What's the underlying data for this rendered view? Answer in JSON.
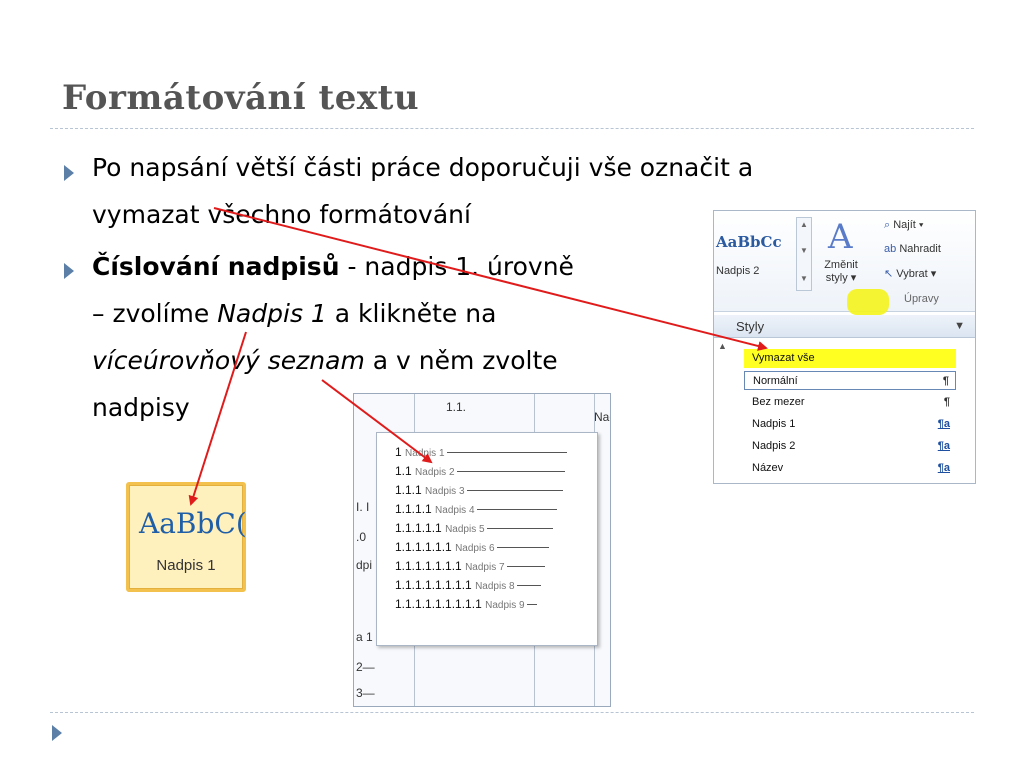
{
  "slide": {
    "title": "Formátování textu",
    "bullet1": {
      "line1": "Po napsání větší části práce doporučuji vše označit a",
      "line2": "vymazat všechno formátování"
    },
    "bullet2": {
      "bold": "Číslování nadpisů",
      "rest1": " - nadpis 1. úrovně",
      "line2a": "– zvolíme ",
      "line2b": "Nadpis 1",
      "line2c": " a klikněte na",
      "line3a": "víceúrovňový seznam",
      "line3b": " a v něm zvolte",
      "line4": "nadpisy"
    }
  },
  "style_tile": {
    "sample": "AaBbC(",
    "name": "Nadpis 1"
  },
  "ribbon": {
    "gallery_sample": "AaBbCc",
    "gallery_name": "Nadpis 2",
    "change_styles_glyph": "A",
    "change_styles_line1": "Změnit",
    "change_styles_line2": "styly ▾",
    "find": "Najít ▾",
    "replace": "Nahradit",
    "select": "Vybrat ▾",
    "group_label": "Úpravy",
    "pane_title": "Styly",
    "styles": [
      {
        "name": "Vymazat vše",
        "mark": ""
      },
      {
        "name": "Normální",
        "mark": "¶"
      },
      {
        "name": "Bez mezer",
        "mark": "¶"
      },
      {
        "name": "Nadpis 1",
        "mark": "¶a"
      },
      {
        "name": "Nadpis 2",
        "mark": "¶a"
      },
      {
        "name": "Název",
        "mark": "¶a"
      }
    ]
  },
  "multilevel": {
    "bg_top_label": "1.1.",
    "bg_right_label": "Nad",
    "bg_left": [
      "I. I",
      ".0",
      "dpi",
      "a 1",
      "2—",
      "3—"
    ],
    "levels": [
      {
        "num": "1",
        "text": "Nadpis 1"
      },
      {
        "num": "1.1",
        "text": "Nadpis 2"
      },
      {
        "num": "1.1.1",
        "text": "Nadpis 3"
      },
      {
        "num": "1.1.1.1",
        "text": "Nadpis 4"
      },
      {
        "num": "1.1.1.1.1",
        "text": "Nadpis 5"
      },
      {
        "num": "1.1.1.1.1.1",
        "text": "Nadpis 6"
      },
      {
        "num": "1.1.1.1.1.1.1",
        "text": "Nadpis 7"
      },
      {
        "num": "1.1.1.1.1.1.1.1",
        "text": "Nadpis 8"
      },
      {
        "num": "1.1.1.1.1.1.1.1.1",
        "text": "Nadpis 9"
      }
    ]
  },
  "colors": {
    "title": "#555555",
    "bullet": "#5c7fa8",
    "arrow": "#e01b1b",
    "highlight": "#ffff22"
  }
}
